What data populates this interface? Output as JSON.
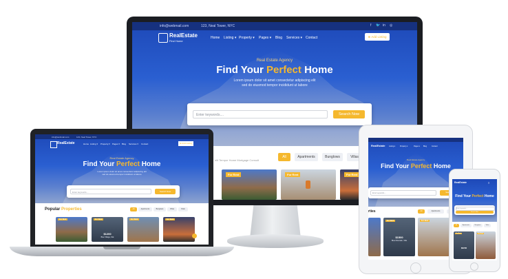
{
  "site": {
    "email": "info@webmail.com",
    "address": "123, Neal Tower, NYC",
    "social": [
      "f",
      "🐦",
      "in",
      "◎"
    ],
    "logo_title": "RealEstate",
    "logo_sub": "Find Home",
    "nav": [
      "Home",
      "Listing ▾",
      "Property ▾",
      "Pages ▾",
      "Blog",
      "Services ▾",
      "Contact"
    ],
    "cta": "⊕ Add Listing",
    "hero_kicker": "Real Estate Agency",
    "hero_title_1": "Find Your",
    "hero_title_accent": "Perfect",
    "hero_title_2": "Home",
    "hero_desc_1": "Lorem ipsum dolor sit amet consectetur adipiscing elit",
    "hero_desc_2": "sed do eiusmod tempor incididunt ut labore",
    "search_placeholder": "Enter keywords....",
    "search_button": "Search Now",
    "section_title": "Popular",
    "section_title_accent": "Properties",
    "section_title_short": "rties",
    "section_sub": "elit Tempor Home Mortgage Consult",
    "filters": [
      "All",
      "Apartments",
      "Bunglows",
      "Villas",
      "Flats"
    ],
    "for_rent": "For Rent",
    "cards": [
      {
        "price": "$1200",
        "name": "Blue Village, Flat"
      },
      {
        "price": "$1500",
        "name": "Blue Mountain, Villa"
      },
      {
        "price": "$2200",
        "name": "Green Bunglow"
      }
    ]
  },
  "colors": {
    "brand_blue": "#1f4fbf",
    "accent": "#f5b82e",
    "device_dark": "#1b1d22"
  }
}
